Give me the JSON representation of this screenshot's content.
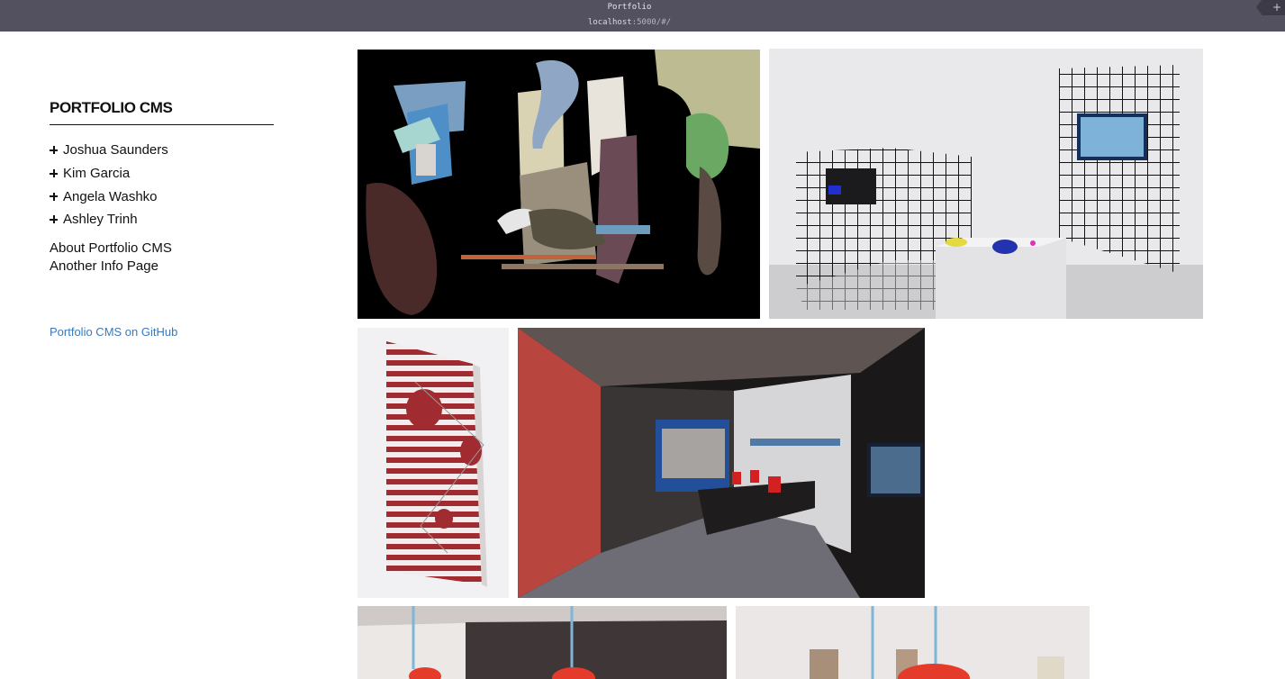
{
  "window": {
    "title": "Portfolio",
    "url_host": "localhost",
    "url_rest": ":5000/#/",
    "corner_symbol": "+"
  },
  "sidebar": {
    "site_title": "PORTFOLIO CMS",
    "artists": [
      {
        "label": "Joshua Saunders",
        "icon": "plus-icon"
      },
      {
        "label": "Kim Garcia",
        "icon": "plus-icon"
      },
      {
        "label": "Angela Washko",
        "icon": "plus-icon"
      },
      {
        "label": "Ashley Trinh",
        "icon": "plus-icon"
      }
    ],
    "pages": [
      "About Portfolio CMS",
      "Another Info Page"
    ],
    "github_link": "Portfolio CMS on GitHub"
  },
  "gallery": {
    "images": [
      {
        "name": "collage-artwork"
      },
      {
        "name": "grid-installation-photo"
      },
      {
        "name": "striped-panel-artwork"
      },
      {
        "name": "dark-room-installation-photo"
      },
      {
        "name": "hanging-sculpture-photo-1"
      },
      {
        "name": "hanging-sculpture-photo-2"
      }
    ]
  },
  "colors": {
    "titlebar": "#53505f",
    "link": "#3b79b8",
    "text": "#111111"
  }
}
